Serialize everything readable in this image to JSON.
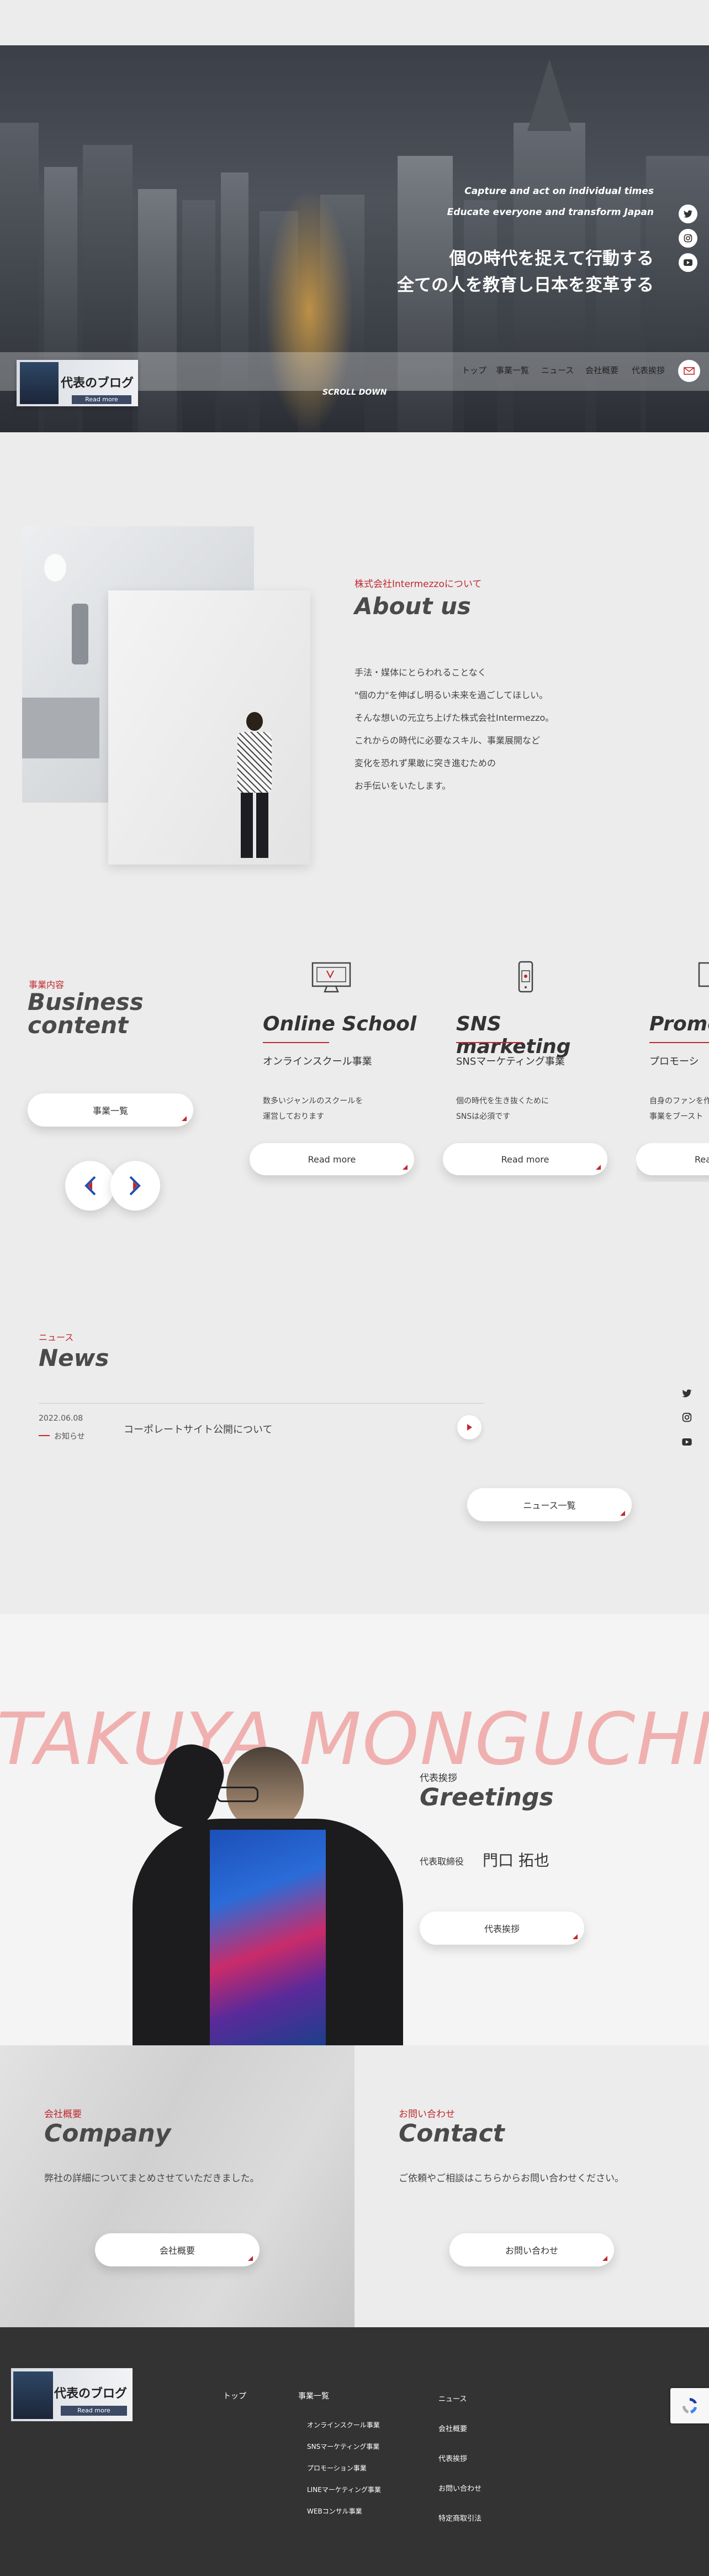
{
  "hero": {
    "tag_en_1": "Capture and act on individual times",
    "tag_en_2": "Educate everyone and transform Japan",
    "tag_jp_1": "個の時代を捉えて行動する",
    "tag_jp_2": "全ての人を教育し日本を変革する",
    "scroll_down": "SCROLL DOWN",
    "blog_banner": {
      "title": "代表のブログ",
      "more": "Read more"
    },
    "nav": [
      "トップ",
      "事業一覧",
      "ニュース",
      "会社概要",
      "代表挨拶"
    ],
    "social_icons": [
      "twitter-icon",
      "instagram-icon",
      "youtube-icon"
    ]
  },
  "about": {
    "label": "株式会社Intermezzoについて",
    "title": "About us",
    "lines": [
      "手法・媒体にとらわれることなく",
      "\"個の力\"を伸ばし明るい未来を過ごしてほしい。",
      "そんな想いの元立ち上げた株式会社Intermezzo。",
      "これからの時代に必要なスキル、事業展開など",
      "変化を恐れず果敢に突き進むための",
      "お手伝いをいたします。"
    ]
  },
  "business": {
    "label": "事業内容",
    "title_1": "Business",
    "title_2": "content",
    "list_button": "事業一覧",
    "cards": [
      {
        "icon": "monitor-icon",
        "title": "Online School",
        "sub": "オンラインスクール事業",
        "desc_1": "数多いジャンルのスクールを",
        "desc_2": "運営しております",
        "button": "Read more"
      },
      {
        "icon": "smartphone-icon",
        "title": "SNS marketing",
        "sub": "SNSマーケティング事業",
        "desc_1": "個の時代を生き抜くために",
        "desc_2": "SNSは必須です",
        "button": "Read more"
      },
      {
        "icon": "monitor-icon",
        "title": "Promo",
        "sub": "プロモーシ",
        "desc_1": "自身のファンを作",
        "desc_2": "事業をブースト",
        "button": "Rea"
      }
    ]
  },
  "news": {
    "label": "ニュース",
    "title": "News",
    "items": [
      {
        "date": "2022.06.08",
        "category": "お知らせ",
        "text": "コーポレートサイト公開について"
      }
    ],
    "list_button": "ニュース一覧"
  },
  "greetings": {
    "bg_name": "TAKUYA MONGUCHI",
    "label": "代表挨拶",
    "title": "Greetings",
    "role": "代表取締役",
    "name": "門口 拓也",
    "button": "代表挨拶"
  },
  "company": {
    "label": "会社概要",
    "title": "Company",
    "desc": "弊社の詳細についてまとめさせていただきました。",
    "button": "会社概要"
  },
  "contact": {
    "label": "お問い合わせ",
    "title": "Contact",
    "desc": "ご依頼やご相談はこちらからお問い合わせください。",
    "button": "お問い合わせ"
  },
  "footer": {
    "blog_title": "代表のブログ",
    "blog_more": "Read more",
    "col1": "トップ",
    "col2_title": "事業一覧",
    "col2_items": [
      "オンラインスクール事業",
      "SNSマーケティング事業",
      "プロモーション事業",
      "LINEマーケティング事業",
      "WEBコンサル事業"
    ],
    "col3": [
      "ニュース",
      "会社概要",
      "代表挨拶",
      "お問い合わせ",
      "特定商取引法"
    ]
  },
  "colors": {
    "accent": "#c0282d",
    "footer_bg": "#333333",
    "greet_bg_text": "#f0b0b0"
  }
}
